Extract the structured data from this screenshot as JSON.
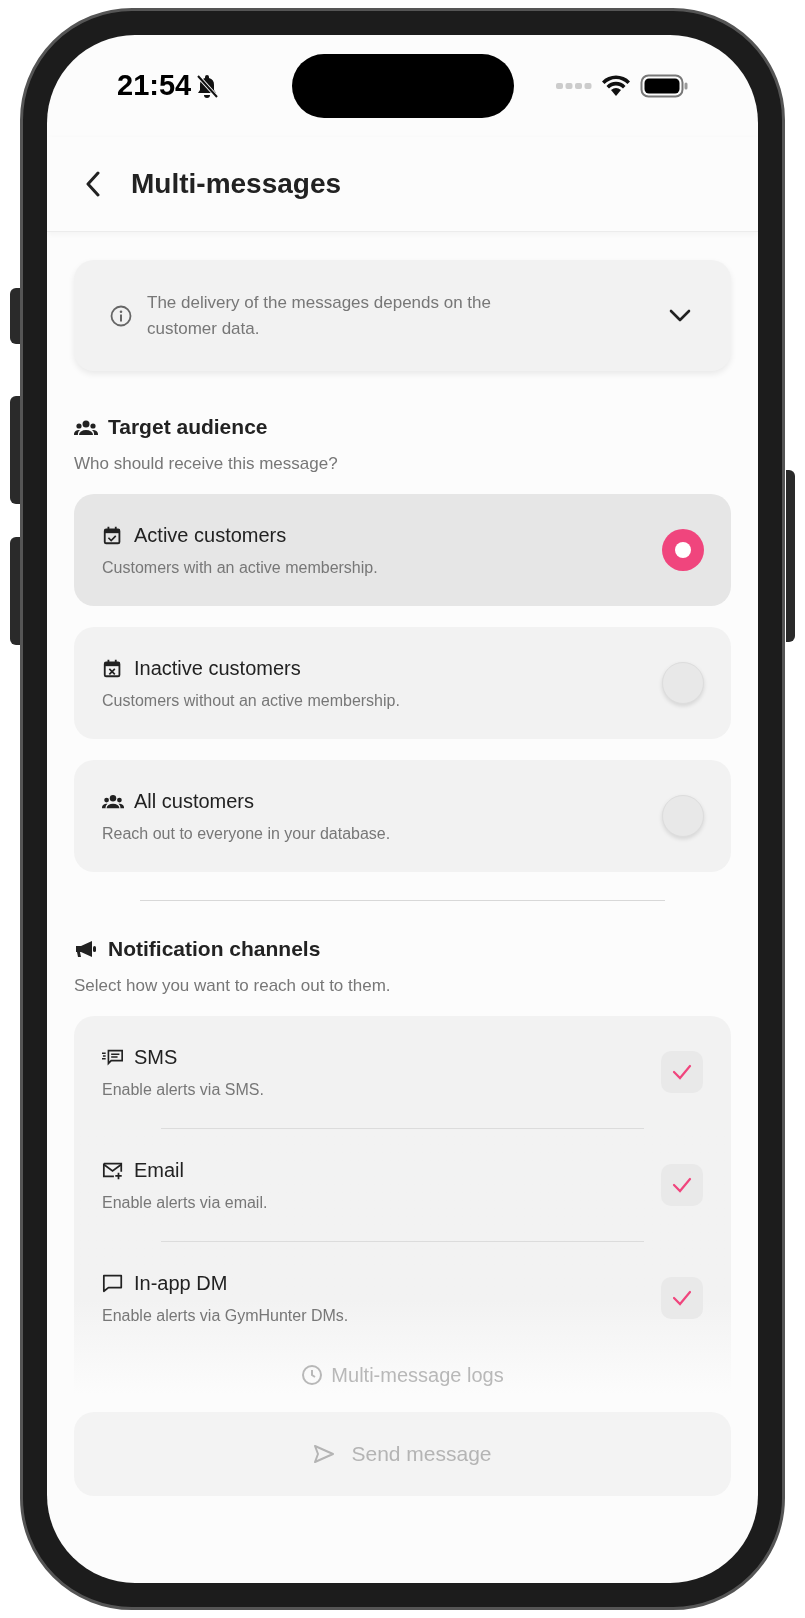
{
  "status_bar": {
    "time": "21:54"
  },
  "header": {
    "title": "Multi-messages"
  },
  "info_banner": {
    "text": "The delivery of the messages depends on the customer data.",
    "expanded": false
  },
  "target_audience": {
    "title": "Target audience",
    "subtitle": "Who should receive this message?",
    "options": [
      {
        "label": "Active customers",
        "description": "Customers with an active membership.",
        "selected": true
      },
      {
        "label": "Inactive customers",
        "description": "Customers without an active membership.",
        "selected": false
      },
      {
        "label": "All customers",
        "description": "Reach out to everyone in your database.",
        "selected": false
      }
    ]
  },
  "notification_channels": {
    "title": "Notification channels",
    "subtitle": "Select how you want to reach out to them.",
    "channels": [
      {
        "label": "SMS",
        "description": "Enable alerts via SMS.",
        "checked": true
      },
      {
        "label": "Email",
        "description": "Enable alerts via email.",
        "checked": true
      },
      {
        "label": "In-app DM",
        "description": "Enable alerts via GymHunter DMs.",
        "checked": true
      }
    ]
  },
  "logs_link": {
    "label": "Multi-message logs"
  },
  "send_button": {
    "label": "Send message",
    "disabled": true
  }
}
